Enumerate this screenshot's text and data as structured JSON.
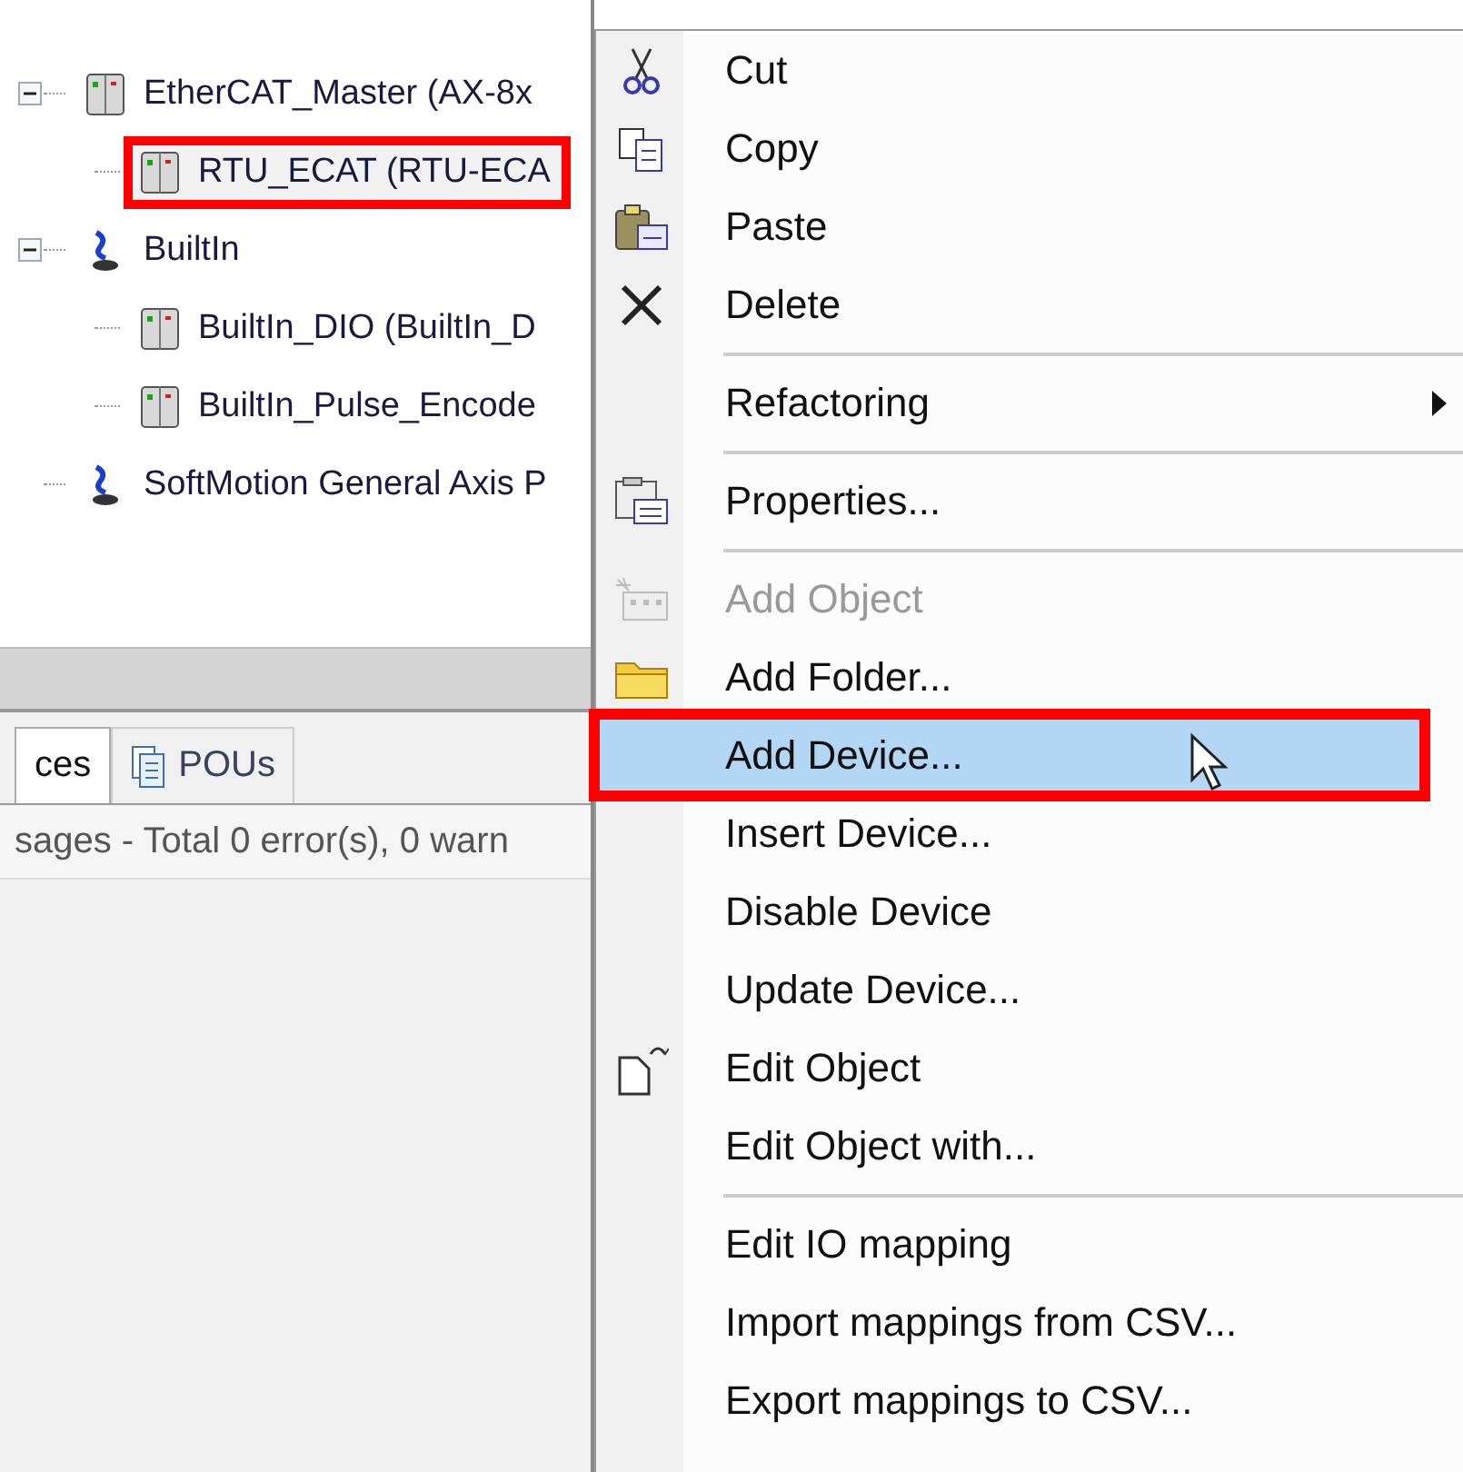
{
  "tree": [
    {
      "label": "EtherCAT_Master (AX-8x",
      "kind": "device",
      "expanded": true,
      "highlighted": false,
      "children": [
        {
          "label": "RTU_ECAT (RTU-ECA",
          "kind": "device",
          "highlighted": true
        }
      ]
    },
    {
      "label": "BuiltIn",
      "kind": "motion",
      "expanded": true,
      "highlighted": false,
      "children": [
        {
          "label": "BuiltIn_DIO (BuiltIn_D",
          "kind": "device",
          "highlighted": false
        },
        {
          "label": "BuiltIn_Pulse_Encode",
          "kind": "device",
          "highlighted": false
        }
      ]
    },
    {
      "label": "SoftMotion General Axis P",
      "kind": "motion",
      "highlighted": false
    }
  ],
  "bottom_tabs": [
    {
      "label": "ces",
      "selected": true,
      "kind": "plain"
    },
    {
      "label": "POUs",
      "selected": false,
      "kind": "document"
    }
  ],
  "messages": "sages - Total 0 error(s), 0 warn",
  "context_menu": [
    {
      "kind": "item",
      "label": "Cut",
      "disabled": false,
      "selected": false,
      "highlighted": false
    },
    {
      "kind": "item",
      "label": "Copy",
      "disabled": false,
      "selected": false,
      "highlighted": false
    },
    {
      "kind": "item",
      "label": "Paste",
      "disabled": false,
      "selected": false,
      "highlighted": false
    },
    {
      "kind": "item",
      "label": "Delete",
      "disabled": false,
      "selected": false,
      "highlighted": false
    },
    {
      "kind": "separator"
    },
    {
      "kind": "submenu",
      "label": "Refactoring",
      "disabled": false,
      "selected": false,
      "highlighted": false
    },
    {
      "kind": "separator"
    },
    {
      "kind": "item",
      "label": "Properties...",
      "disabled": false,
      "selected": false,
      "highlighted": false
    },
    {
      "kind": "separator"
    },
    {
      "kind": "item",
      "label": "Add Object",
      "disabled": true,
      "selected": false,
      "highlighted": false
    },
    {
      "kind": "item",
      "label": "Add Folder...",
      "disabled": false,
      "selected": false,
      "highlighted": false
    },
    {
      "kind": "item",
      "label": "Add Device...",
      "disabled": false,
      "selected": true,
      "highlighted": true
    },
    {
      "kind": "item",
      "label": "Insert Device...",
      "disabled": false,
      "selected": false,
      "highlighted": false
    },
    {
      "kind": "item",
      "label": "Disable Device",
      "disabled": false,
      "selected": false,
      "highlighted": false
    },
    {
      "kind": "item",
      "label": "Update Device...",
      "disabled": false,
      "selected": false,
      "highlighted": false
    },
    {
      "kind": "item",
      "label": "Edit Object",
      "disabled": false,
      "selected": false,
      "highlighted": false
    },
    {
      "kind": "item",
      "label": "Edit Object with...",
      "disabled": false,
      "selected": false,
      "highlighted": false
    },
    {
      "kind": "separator"
    },
    {
      "kind": "item",
      "label": "Edit IO mapping",
      "disabled": false,
      "selected": false,
      "highlighted": false
    },
    {
      "kind": "item",
      "label": "Import mappings from CSV...",
      "disabled": false,
      "selected": false,
      "highlighted": false
    },
    {
      "kind": "item",
      "label": "Export mappings to CSV...",
      "disabled": false,
      "selected": false,
      "highlighted": false
    }
  ]
}
